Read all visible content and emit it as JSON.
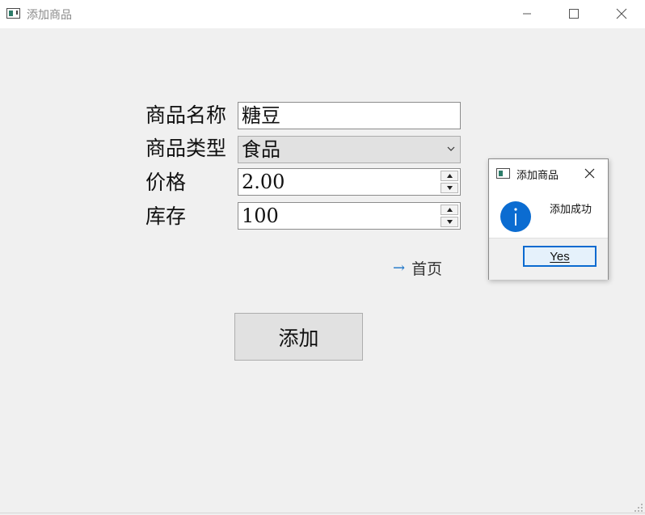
{
  "window": {
    "title": "添加商品",
    "app_icon": "app-window-icon",
    "controls": [
      "minimize-icon",
      "maximize-icon",
      "close-icon"
    ]
  },
  "form": {
    "name": {
      "label": "商品名称",
      "value": "糖豆"
    },
    "type": {
      "label": "商品类型",
      "selected": "食品"
    },
    "price": {
      "label": "价格",
      "value": "2.00"
    },
    "stock": {
      "label": "库存",
      "value": "100"
    }
  },
  "home_link": {
    "icon": "arrow-right-icon",
    "label": "首页"
  },
  "add_button": {
    "label": "添加"
  },
  "dialog": {
    "title": "添加商品",
    "icon": "info-icon",
    "message": "添加成功",
    "yes_label": "Yes",
    "accent": "#0b6cd1"
  }
}
